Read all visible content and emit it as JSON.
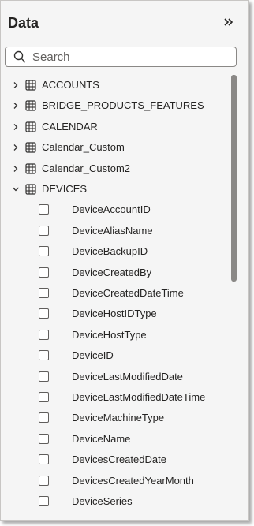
{
  "pane": {
    "title": "Data"
  },
  "search": {
    "placeholder": "Search"
  },
  "tables": [
    {
      "label": "ACCOUNTS",
      "expanded": false
    },
    {
      "label": "BRIDGE_PRODUCTS_FEATURES",
      "expanded": false
    },
    {
      "label": "CALENDAR",
      "expanded": false
    },
    {
      "label": "Calendar_Custom",
      "expanded": false
    },
    {
      "label": "Calendar_Custom2",
      "expanded": false
    },
    {
      "label": "DEVICES",
      "expanded": true
    }
  ],
  "fields": [
    "DeviceAccountID",
    "DeviceAliasName",
    "DeviceBackupID",
    "DeviceCreatedBy",
    "DeviceCreatedDateTime",
    "DeviceHostIDType",
    "DeviceHostType",
    "DeviceID",
    "DeviceLastModifiedDate",
    "DeviceLastModifiedDateTime",
    "DeviceMachineType",
    "DeviceName",
    "DevicesCreatedDate",
    "DevicesCreatedYearMonth",
    "DeviceSeries"
  ],
  "icons": {
    "collapse": "double-chevron-right-icon",
    "search": "search-icon",
    "table": "table-icon",
    "expand": "chevron-right-icon",
    "collapse_node": "chevron-down-icon",
    "checkbox": "checkbox-icon"
  },
  "colors": {
    "pane_bg": "#f5f5f5",
    "text": "#252423",
    "scrollbar": "#8a8886"
  }
}
